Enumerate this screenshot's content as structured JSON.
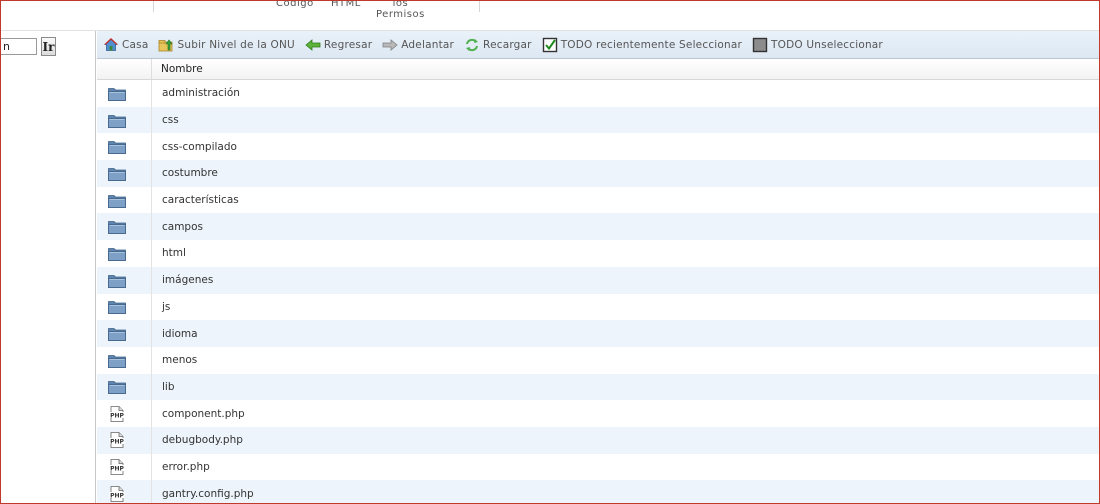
{
  "top_tabs": [
    {
      "label": "Codigo"
    },
    {
      "label": "HTML"
    },
    {
      "label": "los\nPermisos"
    }
  ],
  "left": {
    "search_value": "n",
    "go_label": "Ir"
  },
  "toolbar": {
    "items": [
      {
        "label": "Casa",
        "icon": "home-icon"
      },
      {
        "label": "Subir Nivel de la ONU",
        "icon": "up-level-icon"
      },
      {
        "label": "Regresar",
        "icon": "back-arrow-icon"
      },
      {
        "label": "Adelantar",
        "icon": "forward-arrow-icon"
      },
      {
        "label": "Recargar",
        "icon": "reload-icon"
      },
      {
        "label": "TODO recientemente Seleccionar",
        "icon": "checkbox-checked-icon"
      },
      {
        "label": "TODO Unseleccionar",
        "icon": "checkbox-empty-icon"
      }
    ]
  },
  "table": {
    "header": "Nombre",
    "rows": [
      {
        "name": "administración",
        "type": "folder"
      },
      {
        "name": "css",
        "type": "folder"
      },
      {
        "name": "css-compilado",
        "type": "folder"
      },
      {
        "name": "costumbre",
        "type": "folder"
      },
      {
        "name": "características",
        "type": "folder"
      },
      {
        "name": "campos",
        "type": "folder"
      },
      {
        "name": "html",
        "type": "folder"
      },
      {
        "name": "imágenes",
        "type": "folder"
      },
      {
        "name": "js",
        "type": "folder"
      },
      {
        "name": "idioma",
        "type": "folder"
      },
      {
        "name": "menos",
        "type": "folder"
      },
      {
        "name": "lib",
        "type": "folder"
      },
      {
        "name": "component.php",
        "type": "php"
      },
      {
        "name": "debugbody.php",
        "type": "php"
      },
      {
        "name": "error.php",
        "type": "php"
      },
      {
        "name": "gantry.config.php",
        "type": "php"
      }
    ]
  },
  "colors": {
    "row_alt": "#edf4fb",
    "toolbar_bg": "#dde8f3",
    "folder": "#6f8fb3",
    "frame": "#c0392b"
  }
}
